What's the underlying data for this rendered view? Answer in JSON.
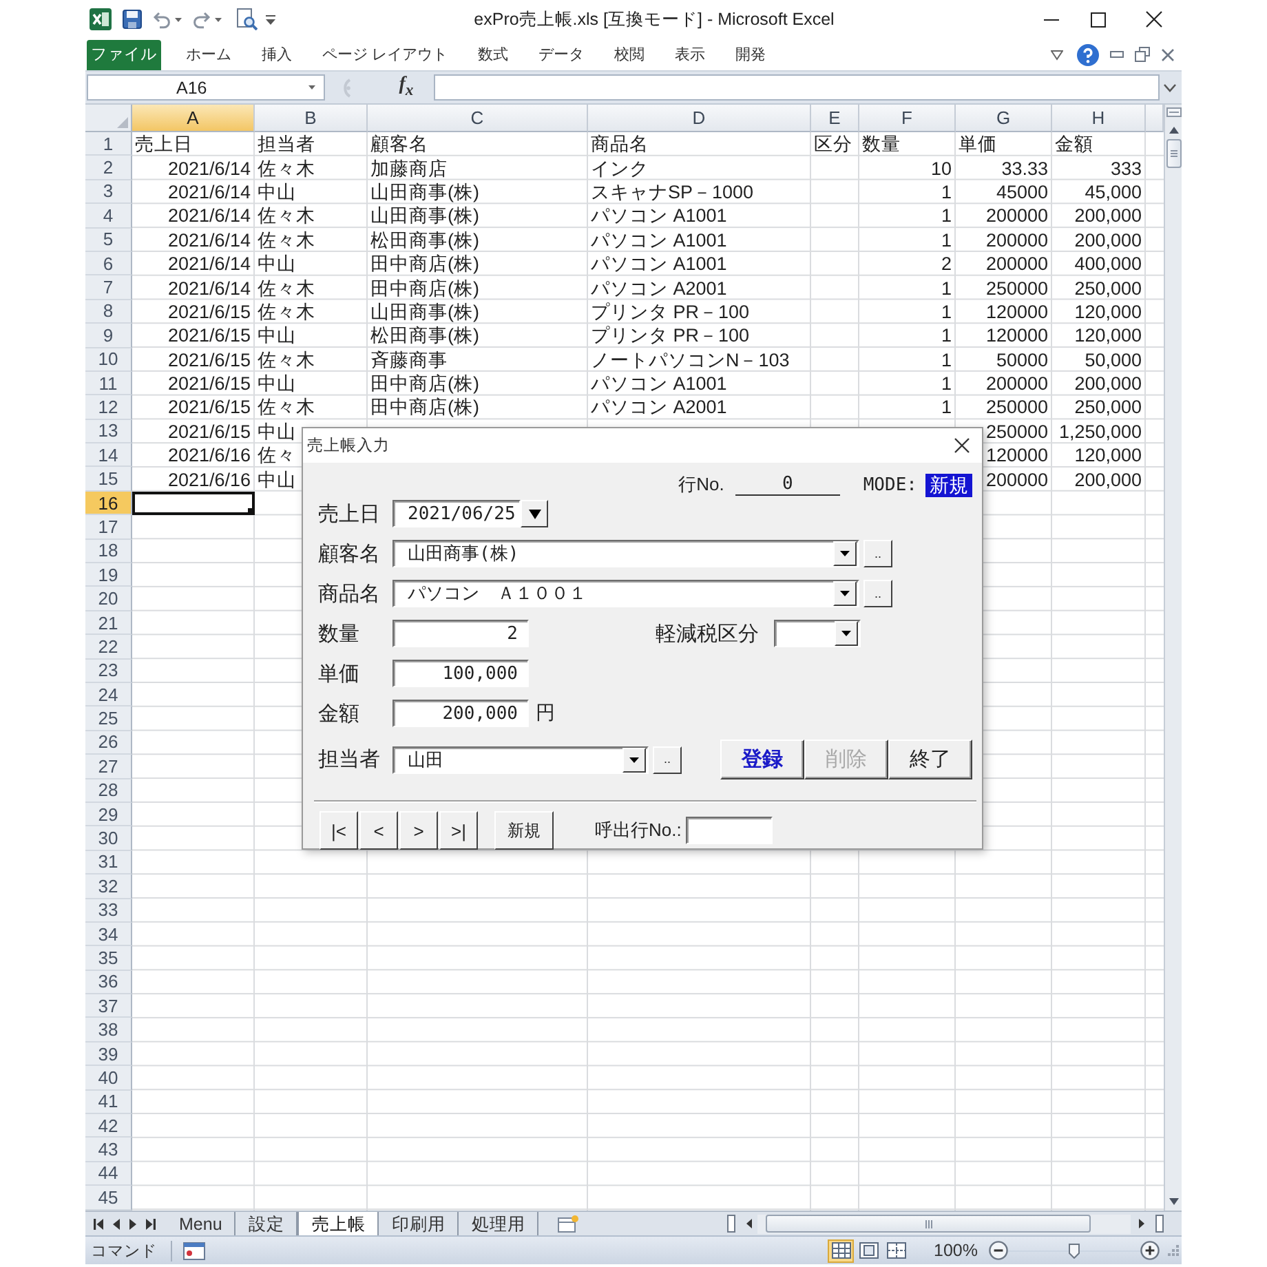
{
  "window": {
    "title": "exPro売上帳.xls [互換モード] - Microsoft Excel"
  },
  "ribbon_tabs": [
    {
      "label": "ファイル",
      "kind": "file"
    },
    {
      "label": "ホーム",
      "kind": "tab"
    },
    {
      "label": "挿入",
      "kind": "tab"
    },
    {
      "label": "ページ レイアウト",
      "kind": "tab"
    },
    {
      "label": "数式",
      "kind": "tab"
    },
    {
      "label": "データ",
      "kind": "tab"
    },
    {
      "label": "校閲",
      "kind": "tab"
    },
    {
      "label": "表示",
      "kind": "tab"
    },
    {
      "label": "開発",
      "kind": "tab"
    }
  ],
  "formula_bar": {
    "name_box": "A16",
    "function_button": "f$_{x}$"
  },
  "sheet": {
    "columns": [
      {
        "label": "A",
        "selected": true
      },
      {
        "label": "B",
        "selected": false
      },
      {
        "label": "C",
        "selected": false
      },
      {
        "label": "D",
        "selected": false
      },
      {
        "label": "E",
        "selected": false
      },
      {
        "label": "F",
        "selected": false
      },
      {
        "label": "G",
        "selected": false
      },
      {
        "label": "H",
        "selected": false
      }
    ],
    "rows": [
      {
        "number": "1",
        "selected": false,
        "kind": "header",
        "cells": {
          "date": "売上日",
          "staff": "担当者",
          "customer": "顧客名",
          "product": "商品名",
          "tax_class": "区分",
          "quantity": "数量",
          "unit_price": "単価",
          "amount": "金額"
        }
      },
      {
        "number": "2",
        "selected": false,
        "kind": "data",
        "cells": {
          "date": "2021/6/14",
          "staff": "佐々木",
          "customer": "加藤商店",
          "product": "インク",
          "quantity": "10",
          "unit_price": "33.33",
          "amount": "333"
        }
      },
      {
        "number": "3",
        "selected": false,
        "kind": "data",
        "cells": {
          "date": "2021/6/14",
          "staff": "中山",
          "customer": "山田商事(株)",
          "product": "スキャナSP－1000",
          "quantity": "1",
          "unit_price": "45000",
          "amount": "45,000"
        }
      },
      {
        "number": "4",
        "selected": false,
        "kind": "data",
        "cells": {
          "date": "2021/6/14",
          "staff": "佐々木",
          "customer": "山田商事(株)",
          "product": "パソコン A1001",
          "quantity": "1",
          "unit_price": "200000",
          "amount": "200,000"
        }
      },
      {
        "number": "5",
        "selected": false,
        "kind": "data",
        "cells": {
          "date": "2021/6/14",
          "staff": "佐々木",
          "customer": "松田商事(株)",
          "product": "パソコン A1001",
          "quantity": "1",
          "unit_price": "200000",
          "amount": "200,000"
        }
      },
      {
        "number": "6",
        "selected": false,
        "kind": "data",
        "cells": {
          "date": "2021/6/14",
          "staff": "中山",
          "customer": "田中商店(株)",
          "product": "パソコン A1001",
          "quantity": "2",
          "unit_price": "200000",
          "amount": "400,000"
        }
      },
      {
        "number": "7",
        "selected": false,
        "kind": "data",
        "cells": {
          "date": "2021/6/14",
          "staff": "佐々木",
          "customer": "田中商店(株)",
          "product": "パソコン A2001",
          "quantity": "1",
          "unit_price": "250000",
          "amount": "250,000"
        }
      },
      {
        "number": "8",
        "selected": false,
        "kind": "data",
        "cells": {
          "date": "2021/6/15",
          "staff": "佐々木",
          "customer": "山田商事(株)",
          "product": "プリンタ PR－100",
          "quantity": "1",
          "unit_price": "120000",
          "amount": "120,000"
        }
      },
      {
        "number": "9",
        "selected": false,
        "kind": "data",
        "cells": {
          "date": "2021/6/15",
          "staff": "中山",
          "customer": "松田商事(株)",
          "product": "プリンタ PR－100",
          "quantity": "1",
          "unit_price": "120000",
          "amount": "120,000"
        }
      },
      {
        "number": "10",
        "selected": false,
        "kind": "data",
        "cells": {
          "date": "2021/6/15",
          "staff": "佐々木",
          "customer": "斉藤商事",
          "product": "ノートパソコンN－103",
          "quantity": "1",
          "unit_price": "50000",
          "amount": "50,000"
        }
      },
      {
        "number": "11",
        "selected": false,
        "kind": "data",
        "cells": {
          "date": "2021/6/15",
          "staff": "中山",
          "customer": "田中商店(株)",
          "product": "パソコン A1001",
          "quantity": "1",
          "unit_price": "200000",
          "amount": "200,000"
        }
      },
      {
        "number": "12",
        "selected": false,
        "kind": "data",
        "cells": {
          "date": "2021/6/15",
          "staff": "佐々木",
          "customer": "田中商店(株)",
          "product": "パソコン A2001",
          "quantity": "1",
          "unit_price": "250000",
          "amount": "250,000"
        }
      },
      {
        "number": "13",
        "selected": false,
        "kind": "data",
        "cells": {
          "date": "2021/6/15",
          "staff": "中山",
          "unit_price": "250000",
          "amount": "1,250,000"
        }
      },
      {
        "number": "14",
        "selected": false,
        "kind": "data",
        "cells": {
          "date": "2021/6/16",
          "staff": "佐々",
          "unit_price": "120000",
          "amount": "120,000"
        }
      },
      {
        "number": "15",
        "selected": false,
        "kind": "data",
        "cells": {
          "date": "2021/6/16",
          "staff": "中山",
          "unit_price": "200000",
          "amount": "200,000"
        }
      },
      {
        "number": "16",
        "selected": true
      },
      {
        "number": "17",
        "selected": false
      },
      {
        "number": "18",
        "selected": false
      },
      {
        "number": "19",
        "selected": false
      },
      {
        "number": "20",
        "selected": false
      },
      {
        "number": "21",
        "selected": false
      },
      {
        "number": "22",
        "selected": false
      },
      {
        "number": "23",
        "selected": false
      },
      {
        "number": "24",
        "selected": false
      },
      {
        "number": "25",
        "selected": false
      },
      {
        "number": "26",
        "selected": false
      },
      {
        "number": "27",
        "selected": false
      },
      {
        "number": "28",
        "selected": false
      },
      {
        "number": "29",
        "selected": false
      },
      {
        "number": "30",
        "selected": false
      },
      {
        "number": "31",
        "selected": false
      },
      {
        "number": "32",
        "selected": false
      },
      {
        "number": "33",
        "selected": false
      },
      {
        "number": "34",
        "selected": false
      },
      {
        "number": "35",
        "selected": false
      },
      {
        "number": "36",
        "selected": false
      },
      {
        "number": "37",
        "selected": false
      },
      {
        "number": "38",
        "selected": false
      },
      {
        "number": "39",
        "selected": false
      },
      {
        "number": "40",
        "selected": false
      },
      {
        "number": "41",
        "selected": false
      },
      {
        "number": "42",
        "selected": false
      },
      {
        "number": "43",
        "selected": false
      },
      {
        "number": "44",
        "selected": false
      },
      {
        "number": "45",
        "selected": false
      }
    ]
  },
  "sheet_tabs": [
    {
      "label": "Menu",
      "selected": false
    },
    {
      "label": "設定",
      "selected": false
    },
    {
      "label": "売上帳",
      "selected": true
    },
    {
      "label": "印刷用",
      "selected": false
    },
    {
      "label": "処理用",
      "selected": false
    }
  ],
  "status_bar": {
    "mode": "コマンド",
    "views": [
      {
        "kind": "normal",
        "selected": true
      },
      {
        "kind": "page_layout",
        "selected": false
      },
      {
        "kind": "page_break",
        "selected": false
      }
    ],
    "zoom": "100%",
    "zoom_slider": {
      "level": 0.5
    }
  },
  "dialog": {
    "title": "売上帳入力",
    "row_number": {
      "label": "行No.",
      "value": "0"
    },
    "mode": {
      "label": "MODE:",
      "value": "新規"
    },
    "fields": [
      {
        "kind": "date",
        "label": "売上日",
        "value": "2021/06/25"
      },
      {
        "kind": "combo",
        "label": "顧客名",
        "value": "山田商事(株)",
        "browse": ".."
      },
      {
        "kind": "combo",
        "label": "商品名",
        "value": "パソコン　Ａ１００１",
        "browse": ".."
      },
      {
        "kind": "number",
        "label": "数量",
        "value": "2",
        "extra": {
          "kind": "combo",
          "label": "軽減税区分"
        }
      },
      {
        "kind": "number",
        "label": "単価",
        "value": "100,000"
      },
      {
        "kind": "number",
        "label": "金額",
        "value": "200,000",
        "unit": "円"
      },
      {
        "kind": "combo",
        "label": "担当者",
        "value": "山田",
        "browse": ".."
      }
    ],
    "actions": [
      {
        "label": "登録",
        "kind": "primary",
        "disabled": false
      },
      {
        "label": "削除",
        "kind": "normal",
        "disabled": true
      },
      {
        "label": "終了",
        "kind": "normal",
        "disabled": false
      }
    ],
    "navigation": [
      "|<",
      "<",
      ">",
      ">|"
    ],
    "new_button": "新規",
    "jump": {
      "label": "呼出行No.:"
    }
  }
}
